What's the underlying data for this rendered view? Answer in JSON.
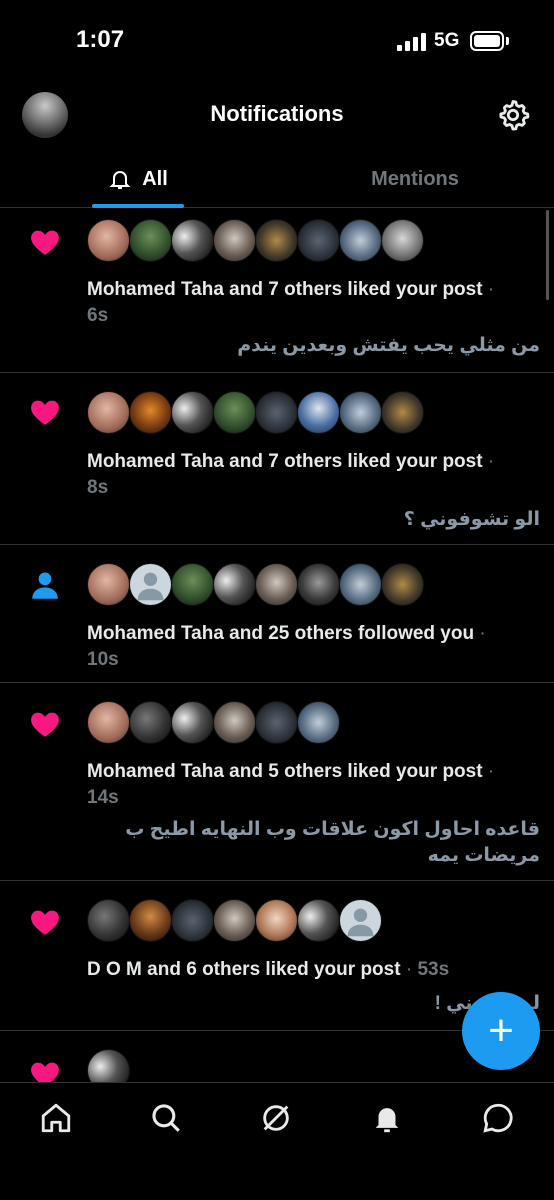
{
  "status_bar": {
    "time": "1:07",
    "network": "5G"
  },
  "header": {
    "title": "Notifications"
  },
  "tabs": [
    {
      "label": "All",
      "active": true
    },
    {
      "label": "Mentions",
      "active": false
    }
  ],
  "notifications": [
    {
      "type": "like",
      "icon": "heart-icon",
      "avatar_count": 8,
      "text": "Mohamed Taha and 7 others liked your post",
      "time": "6s",
      "preview": "من مثلي يحب يفتش وبعدين يندم"
    },
    {
      "type": "like",
      "icon": "heart-icon",
      "avatar_count": 8,
      "text": "Mohamed Taha and 7 others liked your post",
      "time": "8s",
      "preview": "الو تشوفوني ؟"
    },
    {
      "type": "follow",
      "icon": "person-icon",
      "avatar_count": 8,
      "text": "Mohamed Taha and 25 others followed you",
      "time": "10s",
      "preview": ""
    },
    {
      "type": "like",
      "icon": "heart-icon",
      "avatar_count": 6,
      "text": "Mohamed Taha and 5 others liked your post",
      "time": "14s",
      "preview": "قاعده احاول اكون علاقات وب النهايه اطيح ب مريضات يمه"
    },
    {
      "type": "like",
      "icon": "heart-icon",
      "avatar_count": 7,
      "text": "D O M and 6 others liked your post",
      "time": "53s",
      "preview": "لـ ...يفوني !"
    }
  ],
  "colors": {
    "accent": "#1d9bf0",
    "like": "#f91880",
    "muted": "#71767b",
    "background": "#000000"
  },
  "fab": {
    "icon": "plus-icon"
  },
  "bottom_nav": [
    "home-icon",
    "search-icon",
    "grok-icon",
    "notifications-icon",
    "messages-icon"
  ]
}
